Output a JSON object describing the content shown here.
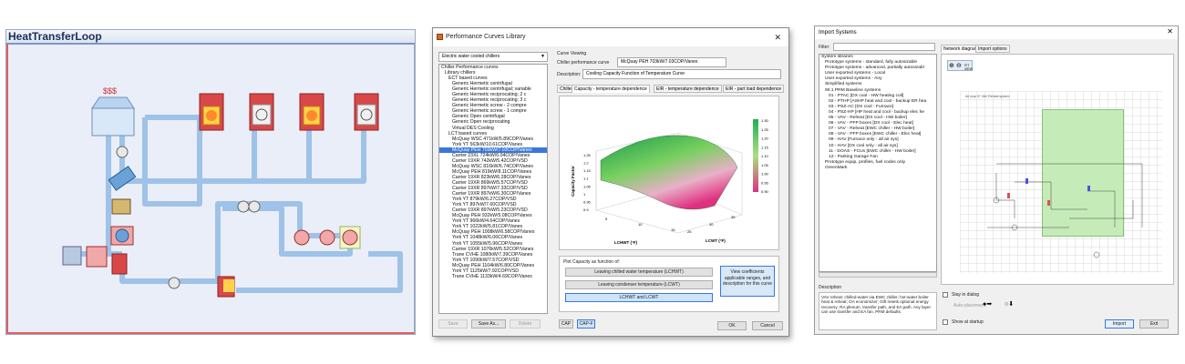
{
  "loop": {
    "title": "HeatTransferLoop"
  },
  "library": {
    "window_title": "Performance Curves Library",
    "category_select": "Electric water cooled chillers",
    "tree": [
      "Chiller Performance curves",
      "Library chillers",
      "ECT based curves",
      "Generic Hermetic centrifugal",
      "Generic Hermetic centrifugal; variable",
      "Generic Hermetic reciprocating; 2 c",
      "Generic Hermetic reciprocating; 3 c",
      "Generic Hermetic screw - 2 compre",
      "Generic Hermetic screw - 1 compre",
      "Generic Open centrifugal",
      "Generic Open reciprocating",
      "Virtual DES Cooling",
      "LCT based curves",
      "McQuay WSC 471kW/5.89COP/Vanes",
      "York YT 563kW/10.61COP/Vanes",
      "McQuay PEH 703kW/7.03COP/Vanes",
      "Carrier 23XL 724kW/6.04COP/Vanes",
      "Carrier 19XR 742kW/5.42COP/VSD",
      "McQuay WSC 816kW/6.74COP/Vanes",
      "McQuay PEH 819kW/8.11COP/Vanes",
      "Carrier 19XR 823kW/6.28COP/Vanes",
      "Carrier 19XR 869kW/5.57COP/VSD",
      "Carrier 19XR 897kW/7.33COP/VSD",
      "Carrier 19XR 897kW/6.30COP/Vanes",
      "York YT 879kW/6.27COP/VSD",
      "York YT 897kW/7.60COP/VSD",
      "Carrier 19XR 897kW/5.23COP/VSD",
      "McQuay PEH 932kW/5.08COP/Vanes",
      "York YT 966kW/4.64COP/Vanes",
      "York YT 1022kW/5.81COP/Vanes",
      "McQuay PEH 1008kW/6.58COP/Vanes",
      "York YT 1048kW/6.06COP/Vanes",
      "York YT 1055kW/5.96COP/Vanes",
      "Carrier 19XR 1076kW/5.52COP/Vanes",
      "Trane CVHE 1080kW/7.39COP/Vanes",
      "York YT 1090kW/7.57COP/VSD",
      "McQuay PEH 1104kW/6.80COP/Vanes",
      "York YT 1125kW/7.92COP/VSD",
      "Trane CVHE 1133kW/4.69COP/Vanes"
    ],
    "selected_index": 15,
    "buttons": {
      "save": "Save",
      "save_as": "Save As...",
      "delete": "Delete",
      "ok": "OK",
      "cancel": "Cancel",
      "cap": "CAP",
      "capf": "CAP-F"
    },
    "curve_viewing": "Curve Viewing",
    "perf_curve_label": "Chiller performance curve",
    "perf_curve_value": "McQuay PEH 703kW/7.03COP/Vanes",
    "description_label": "Description:",
    "description_value": "Cooling Capacity Function of Temperature Curve",
    "tabs": [
      "Chiller",
      "Capacity - temperature dependence",
      "EIR - temperature dependence",
      "EIR - part load dependence"
    ],
    "z_ticks": [
      "1.25",
      "1.2",
      "1.15",
      "1.1",
      "1.05",
      "1",
      "0.95",
      "0.9"
    ],
    "legend_ticks": [
      "1.30",
      "1.25",
      "1.20",
      "1.15",
      "1.10",
      "1.05",
      "1.00",
      "0.95",
      "0.90"
    ],
    "x_ticks": [
      "5",
      "10",
      "15"
    ],
    "y_ticks": [
      "25",
      "30",
      "35"
    ],
    "zlabel": "Capacity Factor",
    "xlabel": "LCHWT (°F)",
    "ylabel": "LCWT (°F)",
    "plot_as": "Plot Capacity as function of:",
    "options": [
      "Leaving chilled water temperature (LCHWT)",
      "Leaving condenser temperature (LCWT)",
      "LCHWT and LCWT"
    ],
    "view_coeff": "View coefficients applicable ranges, and description for this curve"
  },
  "import": {
    "window_title": "Import Systems",
    "filter_label": "Filter:",
    "tree": [
      "System libraries",
      "Prototype systems - standard, fully autosizable",
      "Prototype systems - advanced, partially autosizabl",
      "User exported systems - Local",
      "User exported systems - Any",
      "Simplified systems",
      "90.1 PRM Baseline systems",
      "01 - PTAC [DX cool - HW heating coil]",
      "02 - PTHP [ASHP heat and cool - backup ER hea",
      "03 - PSZ-AC [DX cool - Furnace]",
      "04 - PSZ-HP [HP heat and cool - backup elec he",
      "05 - VAV - Reheat [DX cool - HW boiler]",
      "06 - VAV - PFP boxes [DX cool - Elec heat]",
      "07 - VAV - Reheat [EWC chiller - HW boiler]",
      "08 - VAV - PFP boxes [EWC chiller - Elec heat]",
      "09 - HAV [Furnace only - all air sys]",
      "10 - HAV [DX cool only - all air sys]",
      "11 - DOAS - FCUs [EWC chiller - HW boiler]",
      "12 - Parking Garage Fan",
      "Prototype equip, profiles, fuel codes only",
      "GreenMark"
    ],
    "selected_index": 13,
    "tabs": [
      "Network diagram",
      "Import options"
    ],
    "description_label": "Description",
    "description_text": "VAV reheat: chilled-water via EWC chiller; hot-water boiler heat & reheat; OA economizer; Gift resets optional energy recovery; RA plenum, transfer path, and EA path. Any layer can use transfer and EA fan. PRM defaults.",
    "stay_in_dialog": "Stay in dialog",
    "auto_placement": "Auto-placement:",
    "show_at_startup": "Show at startup",
    "import_btn": "Import",
    "exit_btn": "Exit",
    "zoom_label": "FIT VIEW",
    "diagram_caption": "Air loop 07 VAV Reheat system"
  },
  "colors": {
    "pipe": "#8bb7e0",
    "selection": "#3a78d8",
    "green_zone": "#c5ecb8"
  }
}
